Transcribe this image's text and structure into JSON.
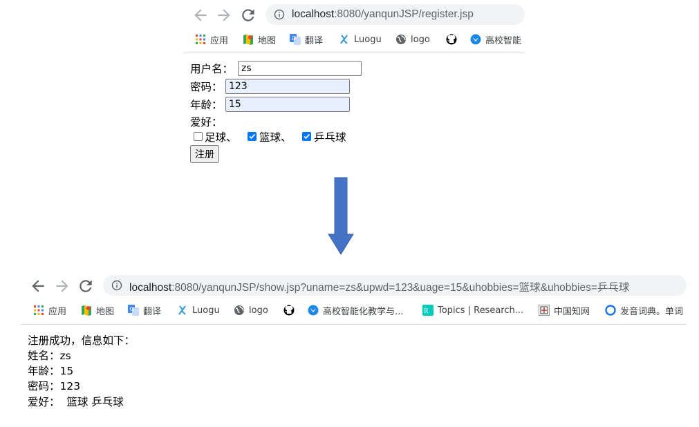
{
  "top_browser": {
    "url_host": "localhost",
    "url_rest": ":8080/yanqunJSP/register.jsp",
    "bookmarks": [
      {
        "label": "应用",
        "icon": "apps-grid-icon"
      },
      {
        "label": "地图",
        "icon": "maps-icon"
      },
      {
        "label": "翻译",
        "icon": "translate-icon"
      },
      {
        "label": "Luogu",
        "icon": "luogu-icon"
      },
      {
        "label": "logo",
        "icon": "globe-icon"
      },
      {
        "label": "",
        "icon": "github-icon"
      },
      {
        "label": "高校智能",
        "icon": "bird-icon"
      }
    ]
  },
  "form": {
    "username_label": "用户名：",
    "username_value": "zs",
    "password_label": "密码：",
    "password_value": "123",
    "age_label": "年龄：",
    "age_value": "15",
    "hobby_label": "爱好：",
    "hobbies": [
      {
        "label": "足球、",
        "checked": false
      },
      {
        "label": "篮球、",
        "checked": true
      },
      {
        "label": "乒乓球",
        "checked": true
      }
    ],
    "submit_label": "注册"
  },
  "arrow_color": "#4472c4",
  "bottom_browser": {
    "url_host": "localhost",
    "url_rest": ":8080/yanqunJSP/show.jsp?uname=zs&upwd=123&uage=15&uhobbies=篮球&uhobbies=乒乓球",
    "bookmarks": [
      {
        "label": "应用",
        "icon": "apps-grid-icon"
      },
      {
        "label": "地图",
        "icon": "maps-icon"
      },
      {
        "label": "翻译",
        "icon": "translate-icon"
      },
      {
        "label": "Luogu",
        "icon": "luogu-icon"
      },
      {
        "label": "logo",
        "icon": "globe-icon"
      },
      {
        "label": "",
        "icon": "github-icon"
      },
      {
        "label": "高校智能化教学与...",
        "icon": "bird-icon"
      },
      {
        "label": "Topics | Research...",
        "icon": "researchgate-icon"
      },
      {
        "label": "中国知网",
        "icon": "cnki-icon"
      },
      {
        "label": "发音词典。单词",
        "icon": "circle-icon"
      }
    ]
  },
  "result": {
    "heading": "注册成功，信息如下：",
    "name_line": "姓名：zs",
    "age_line": "年龄：15",
    "password_line": "密码：123",
    "hobby_line": "爱好：  篮球 乒乓球"
  }
}
